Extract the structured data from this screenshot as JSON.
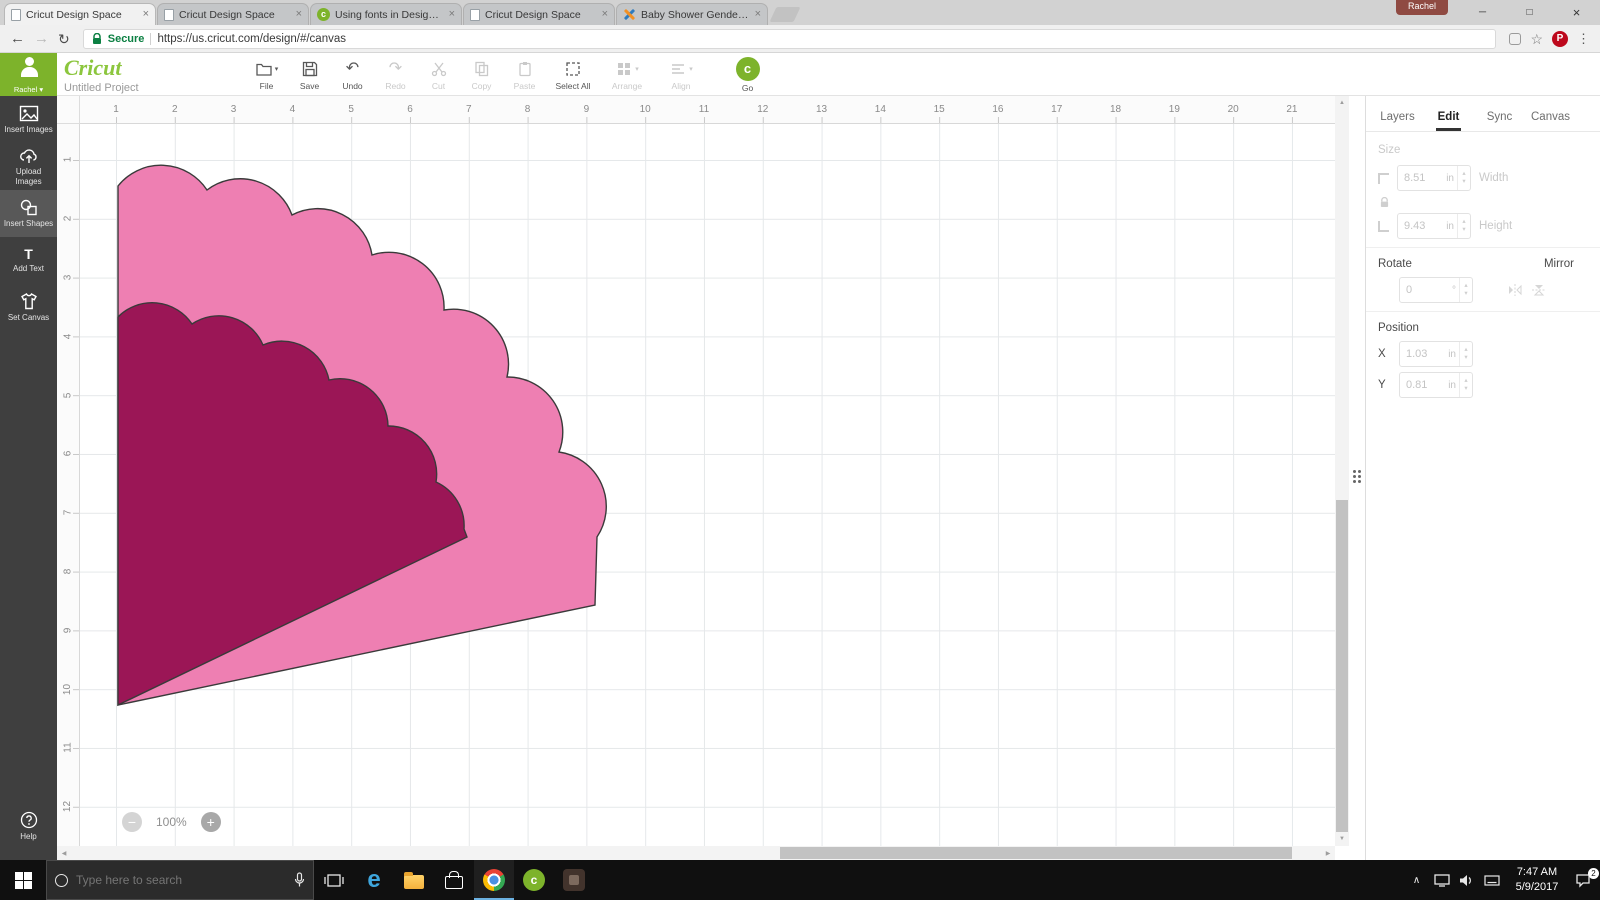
{
  "icons": {
    "back": "←",
    "forward": "→",
    "reload": "↻",
    "star": "☆",
    "menu_dots": "⋮",
    "caret_down": "▾",
    "undo": "↶",
    "redo": "↷",
    "close": "×",
    "minimize": "─",
    "maximize": "□",
    "minus": "−",
    "plus": "+",
    "up": "▲",
    "down": "▼",
    "left": "◀",
    "right": "▶",
    "stepper_up": "▴",
    "stepper_down": "▾",
    "chevron_up": "∧",
    "question": "?",
    "pinterest_p": "P",
    "cricut_c": "c",
    "edge_e": "e",
    "text_tool": "T"
  },
  "browser": {
    "profile_badge": "Rachel",
    "tabs": [
      {
        "title": "Cricut Design Space",
        "active": true
      },
      {
        "title": "Cricut Design Space",
        "active": false
      },
      {
        "title": "Using fonts in Design Sp",
        "active": false
      },
      {
        "title": "Cricut Design Space",
        "active": false
      },
      {
        "title": "Baby Shower Gender Re",
        "active": false
      }
    ],
    "nav": {
      "security": "Secure",
      "url": "https://us.cricut.com/design/#/canvas"
    }
  },
  "app": {
    "logo": "Cricut",
    "project": "Untitled Project",
    "user": "Rachel",
    "toolbar": [
      {
        "label": "File",
        "enabled": true
      },
      {
        "label": "Save",
        "enabled": true
      },
      {
        "label": "Undo",
        "enabled": true
      },
      {
        "label": "Redo",
        "enabled": false
      },
      {
        "label": "Cut",
        "enabled": false
      },
      {
        "label": "Copy",
        "enabled": false
      },
      {
        "label": "Paste",
        "enabled": false
      },
      {
        "label": "Select All",
        "enabled": true
      },
      {
        "label": "Arrange",
        "enabled": false
      },
      {
        "label": "Align",
        "enabled": false
      },
      {
        "label": "Go",
        "enabled": true
      }
    ]
  },
  "sidebar": {
    "items": [
      {
        "label": "Insert Images",
        "active": false
      },
      {
        "label": "Upload Images",
        "active": false
      },
      {
        "label": "Insert Shapes",
        "active": true
      },
      {
        "label": "Add Text",
        "active": false
      },
      {
        "label": "Set Canvas",
        "active": false
      }
    ],
    "help": "Help"
  },
  "canvas": {
    "ruler_top": [
      "1",
      "2",
      "3",
      "4",
      "5",
      "6",
      "7",
      "8",
      "9",
      "10",
      "11",
      "12",
      "13",
      "14",
      "15",
      "16",
      "17",
      "18",
      "19",
      "20",
      "21"
    ],
    "ruler_left": [
      "1",
      "2",
      "3",
      "4",
      "5",
      "6",
      "7",
      "8",
      "9",
      "10",
      "11",
      "12"
    ],
    "zoom_level": "100%",
    "shapes": [
      {
        "name": "scalloped layer light pink",
        "fill": "#ee7fb2"
      },
      {
        "name": "scalloped layer dark pink",
        "fill": "#9b1656"
      }
    ]
  },
  "panel": {
    "tabs": [
      {
        "label": "Layers",
        "active": false
      },
      {
        "label": "Edit",
        "active": true
      },
      {
        "label": "Sync",
        "active": false
      },
      {
        "label": "Canvas",
        "active": false
      }
    ],
    "size_label": "Size",
    "width": {
      "value": "8.51",
      "unit": "in",
      "label": "Width"
    },
    "height": {
      "value": "9.43",
      "unit": "in",
      "label": "Height"
    },
    "rotate_label": "Rotate",
    "rotate": {
      "value": "0",
      "unit": "°"
    },
    "mirror_label": "Mirror",
    "position_label": "Position",
    "pos_x": {
      "axis": "X",
      "value": "1.03",
      "unit": "in"
    },
    "pos_y": {
      "axis": "Y",
      "value": "0.81",
      "unit": "in"
    }
  },
  "taskbar": {
    "search_placeholder": "Type here to search",
    "clock": {
      "time": "7:47 AM",
      "date": "5/9/2017"
    },
    "notification_count": "2"
  },
  "colors": {
    "accent_green": "#7db32b",
    "light_pink": "#ee7fb2",
    "dark_pink": "#9b1656"
  }
}
